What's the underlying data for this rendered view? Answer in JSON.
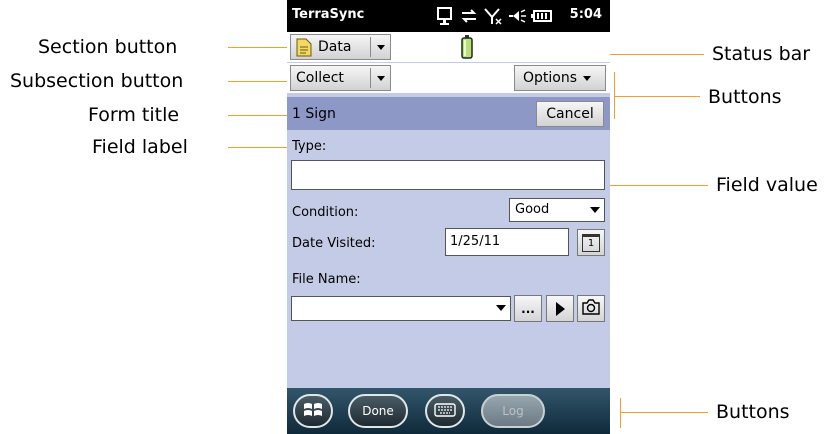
{
  "annotations": {
    "section_button": "Section button",
    "subsection_button": "Subsection button",
    "form_title": "Form title",
    "field_label": "Field label",
    "status_bar": "Status bar",
    "buttons_top": "Buttons",
    "field_value": "Field value",
    "buttons_bottom": "Buttons"
  },
  "titlebar": {
    "app_name": "TerraSync",
    "time": "5:04"
  },
  "toolbar": {
    "section_label": "Data",
    "subsection_label": "Collect",
    "options_label": "Options"
  },
  "form": {
    "title": "1 Sign",
    "cancel_label": "Cancel",
    "type_label": "Type:",
    "type_value": "",
    "condition_label": "Condition:",
    "condition_value": "Good",
    "date_label": "Date Visited:",
    "date_value": "1/25/11",
    "calendar_glyph": "1",
    "filename_label": "File Name:",
    "filename_value": "",
    "browse_label": "..."
  },
  "bottom_bar": {
    "done_label": "Done",
    "log_label": "Log"
  },
  "colors": {
    "form_bg": "#c4cbe6",
    "form_header": "#8d98c6",
    "callout_line": "#f0a030"
  }
}
